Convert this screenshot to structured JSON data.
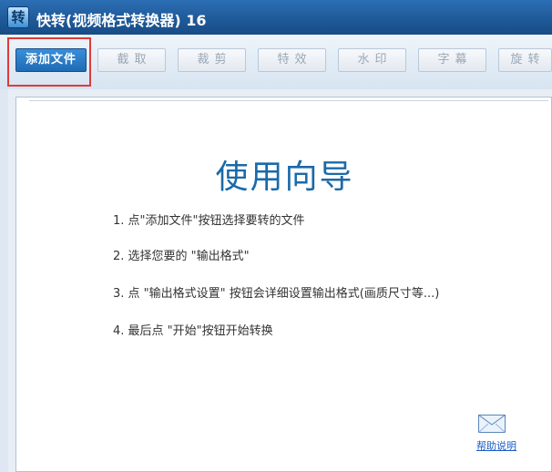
{
  "window": {
    "icon_char": "转",
    "title": "快转(视频格式转换器) 16"
  },
  "toolbar": {
    "buttons": [
      {
        "label": "添加文件"
      },
      {
        "label": "截取"
      },
      {
        "label": "裁剪"
      },
      {
        "label": "特效"
      },
      {
        "label": "水印"
      },
      {
        "label": "字幕"
      },
      {
        "label": "旋转"
      }
    ]
  },
  "guide": {
    "title": "使用向导",
    "steps": [
      "1. 点\"添加文件\"按钮选择要转的文件",
      "2. 选择您要的 \"输出格式\"",
      "3. 点 \"输出格式设置\" 按钮会详细设置输出格式(画质尺寸等...)",
      "4. 最后点 \"开始\"按钮开始转换"
    ]
  },
  "help": {
    "icon": "mail-icon",
    "label": "帮助说明"
  },
  "colors": {
    "titlebar": "#1f5a99",
    "primary_button": "#2a7bc6",
    "highlight": "#e03a3a",
    "guide_title": "#1b6aa8",
    "link": "#1a5cc8"
  }
}
